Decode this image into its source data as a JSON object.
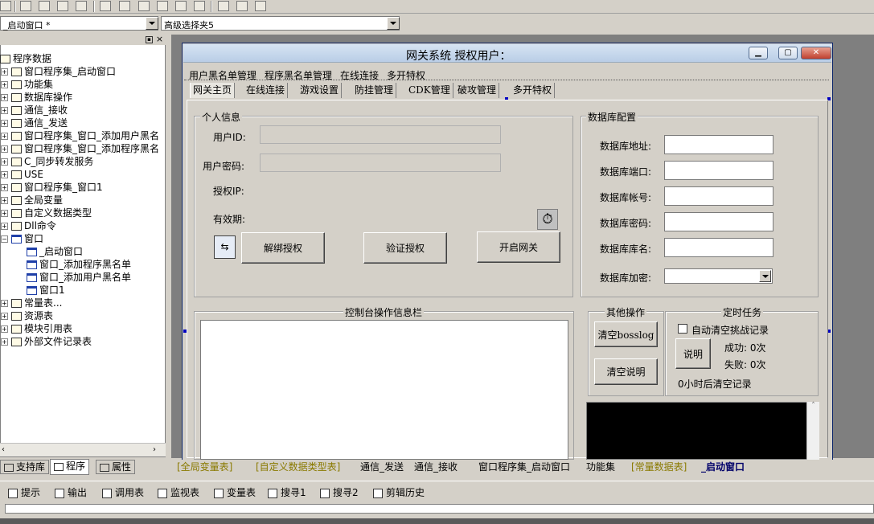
{
  "ide": {
    "component_combo": "_启动窗口 *",
    "property_combo": "高级选择夹5",
    "tree": [
      {
        "label": "程序数据",
        "icon": "program-data-icon",
        "indent": 0
      },
      {
        "label": "窗口程序集_启动窗口",
        "icon": "module-icon",
        "indent": 1
      },
      {
        "label": "功能集",
        "icon": "module-icon",
        "indent": 1
      },
      {
        "label": "数据库操作",
        "icon": "module-icon",
        "indent": 1
      },
      {
        "label": "通信_接收",
        "icon": "module-icon",
        "indent": 1
      },
      {
        "label": "通信_发送",
        "icon": "module-icon",
        "indent": 1
      },
      {
        "label": "窗口程序集_窗口_添加用户黑名",
        "icon": "module-icon",
        "indent": 1
      },
      {
        "label": "窗口程序集_窗口_添加程序黑名",
        "icon": "module-icon",
        "indent": 1
      },
      {
        "label": "C_同步转发服务",
        "icon": "module-icon",
        "indent": 1
      },
      {
        "label": "USE",
        "icon": "module-icon",
        "indent": 1
      },
      {
        "label": "窗口程序集_窗口1",
        "icon": "module-icon",
        "indent": 1
      },
      {
        "label": "全局变量",
        "icon": "global-var-icon",
        "indent": 1
      },
      {
        "label": "自定义数据类型",
        "icon": "datatype-icon",
        "indent": 1
      },
      {
        "label": "Dll命令",
        "icon": "dll-icon",
        "indent": 1
      },
      {
        "label": "窗口",
        "icon": "window-icon",
        "indent": 1
      },
      {
        "label": "_启动窗口",
        "icon": "window-icon",
        "indent": 2
      },
      {
        "label": "窗口_添加程序黑名单",
        "icon": "window-icon",
        "indent": 2
      },
      {
        "label": "窗口_添加用户黑名单",
        "icon": "window-icon",
        "indent": 2
      },
      {
        "label": "窗口1",
        "icon": "window-icon",
        "indent": 2
      },
      {
        "label": "常量表...",
        "icon": "constant-icon",
        "indent": 1
      },
      {
        "label": "资源表",
        "icon": "resource-icon",
        "indent": 1
      },
      {
        "label": "模块引用表",
        "icon": "module-ref-icon",
        "indent": 1
      },
      {
        "label": "外部文件记录表",
        "icon": "file-record-icon",
        "indent": 1
      }
    ],
    "left_tabs": [
      "支持库",
      "程序",
      "属性"
    ],
    "doc_tabs": [
      "[全局变量表]",
      "[自定义数据类型表]",
      "通信_发送",
      "通信_接收",
      "窗口程序集_启动窗口",
      "功能集",
      "[常量数据表]",
      "_启动窗口"
    ],
    "status_items": [
      "提示",
      "输出",
      "调用表",
      "监视表",
      "变量表",
      "搜寻1",
      "搜寻2",
      "剪辑历史"
    ]
  },
  "form": {
    "title": "网关系统  授权用户：",
    "menu": [
      "用户黑名单管理",
      "程序黑名单管理",
      "在线连接",
      "多开特权"
    ],
    "tabs": [
      "网关主页",
      "在线连接",
      "游戏设置",
      "防挂管理",
      "CDK管理",
      "破攻管理",
      "多开特权"
    ],
    "personal": {
      "title": "个人信息",
      "user_id_label": "用户ID:",
      "password_label": "用户密码:",
      "auth_ip_label": "授权IP:",
      "validity_label": "有效期:",
      "unbind_btn": "解绑授权",
      "verify_btn": "验证授权",
      "start_btn": "开启网关"
    },
    "db": {
      "title": "数据库配置",
      "address_label": "数据库地址:",
      "port_label": "数据库端口:",
      "account_label": "数据库帐号:",
      "password_label": "数据库密码:",
      "name_label": "数据库库名:",
      "encrypt_label": "数据库加密:"
    },
    "console_title": "控制台操作信息栏",
    "other": {
      "title": "其他操作",
      "clear_boss_btn": "清空bosslog",
      "clear_desc_btn": "清空说明"
    },
    "timer": {
      "title": "定时任务",
      "auto_clear_label": "自动清空挑战记录",
      "desc_btn": "说明",
      "success_text": "成功: 0次",
      "fail_text": "失败: 0次",
      "hours_text": "0小时后清空记录"
    }
  }
}
